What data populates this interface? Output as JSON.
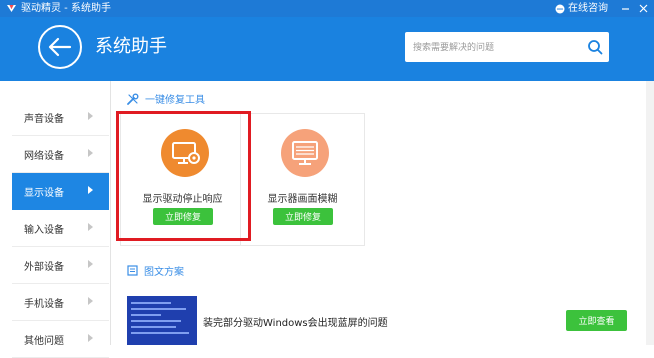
{
  "window": {
    "title": "驱动精灵 - 系统助手",
    "consult_label": "在线咨询"
  },
  "header": {
    "page_title": "系统助手",
    "search_placeholder": "搜索需要解决的问题"
  },
  "sidebar": {
    "items": [
      {
        "label": "声音设备"
      },
      {
        "label": "网络设备"
      },
      {
        "label": "显示设备",
        "active": true
      },
      {
        "label": "输入设备"
      },
      {
        "label": "外部设备"
      },
      {
        "label": "手机设备"
      },
      {
        "label": "其他问题"
      }
    ]
  },
  "repair_section": {
    "heading": "一键修复工具",
    "cards": [
      {
        "label": "显示驱动停止响应",
        "button": "立即修复",
        "icon": "monitor-gear-icon",
        "color": "#ef8a2f"
      },
      {
        "label": "显示器画面模糊",
        "button": "立即修复",
        "icon": "monitor-icon",
        "color": "#f6a27a"
      }
    ]
  },
  "solutions_section": {
    "heading": "图文方案",
    "items": [
      {
        "title": "装完部分驱动Windows会出现蓝屏的问题",
        "button": "立即查看"
      }
    ]
  },
  "colors": {
    "brand_blue": "#1a82e0",
    "accent_green": "#3cc23c",
    "highlight_red": "#e01b22"
  }
}
